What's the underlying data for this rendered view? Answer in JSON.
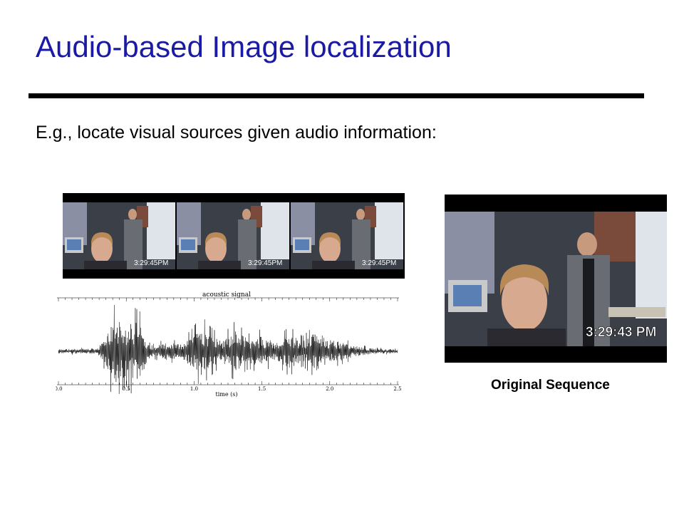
{
  "slide": {
    "title": "Audio-based Image localization",
    "bullet": "E.g., locate visual sources given audio information:",
    "caption": "Original Sequence"
  },
  "frames": {
    "strip_timestamps": [
      "3:29:45PM",
      "3:29:45PM",
      "3:29:45PM"
    ],
    "main_timestamp": "3:29:43 PM"
  },
  "chart_data": {
    "type": "line",
    "title": "acoustic signal",
    "xlabel": "time (s)",
    "ylabel": "",
    "xlim": [
      0.0,
      2.5
    ],
    "x_ticks": [
      "0.0",
      "0.5",
      "1.0",
      "1.5",
      "2.0",
      "2.5"
    ],
    "grid": false,
    "legend": "none",
    "series": [
      {
        "envelope_x": [
          0.0,
          0.3,
          0.35,
          0.4,
          0.45,
          0.5,
          0.55,
          0.6,
          0.65,
          0.7,
          0.8,
          0.9,
          1.0,
          1.05,
          1.1,
          1.2,
          1.3,
          1.4,
          1.5,
          1.6,
          1.7,
          1.8,
          1.9,
          2.0,
          2.1,
          2.2,
          2.3,
          2.5
        ],
        "envelope_amp": [
          0.06,
          0.08,
          0.45,
          0.95,
          0.85,
          0.7,
          0.9,
          0.8,
          0.35,
          0.15,
          0.25,
          0.2,
          0.5,
          0.75,
          0.55,
          0.3,
          0.6,
          0.35,
          0.45,
          0.25,
          0.5,
          0.3,
          0.55,
          0.35,
          0.25,
          0.15,
          0.08,
          0.05
        ]
      }
    ]
  }
}
